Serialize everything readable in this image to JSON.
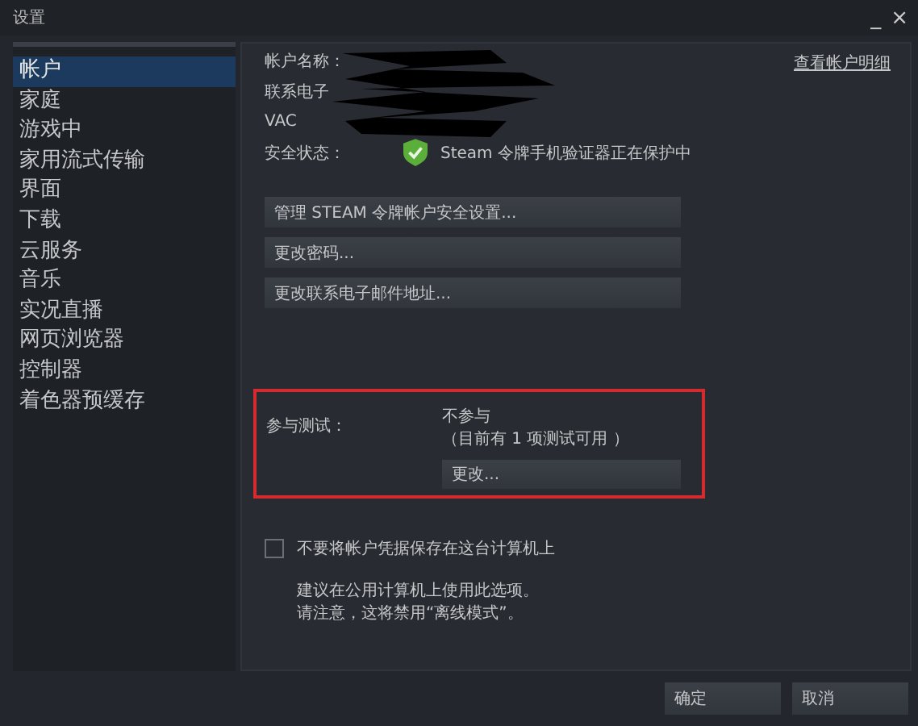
{
  "window": {
    "title": "设置",
    "minimize": "_",
    "close": "×"
  },
  "sidebar": {
    "items": [
      {
        "label": "帐户",
        "selected": true
      },
      {
        "label": "家庭",
        "selected": false
      },
      {
        "label": "游戏中",
        "selected": false
      },
      {
        "label": "家用流式传输",
        "selected": false
      },
      {
        "label": "界面",
        "selected": false
      },
      {
        "label": "下载",
        "selected": false
      },
      {
        "label": "云服务",
        "selected": false
      },
      {
        "label": "音乐",
        "selected": false
      },
      {
        "label": "实况直播",
        "selected": false
      },
      {
        "label": "网页浏览器",
        "selected": false
      },
      {
        "label": "控制器",
        "selected": false
      },
      {
        "label": "着色器预缓存",
        "selected": false
      }
    ]
  },
  "account": {
    "fields": [
      {
        "label": "帐户名称："
      },
      {
        "label": "联系电子"
      },
      {
        "label": "VAC"
      }
    ],
    "details_link": "查看帐户明细",
    "security": {
      "label": "安全状态：",
      "value": "Steam 令牌手机验证器正在保护中"
    },
    "buttons": [
      "管理 STEAM 令牌帐户安全设置...",
      "更改密码...",
      "更改联系电子邮件地址..."
    ]
  },
  "beta": {
    "label": "参与测试：",
    "value": "不参与",
    "note": "（目前有 1 项测试可用 ）",
    "button": "更改..."
  },
  "credentials": {
    "label": "不要将帐户凭据保存在这台计算机上",
    "checked": false,
    "hint_lines": [
      "建议在公用计算机上使用此选项。",
      "请注意，这将禁用“离线模式”。"
    ]
  },
  "footer": {
    "buttons": [
      "确定",
      "取消"
    ]
  }
}
